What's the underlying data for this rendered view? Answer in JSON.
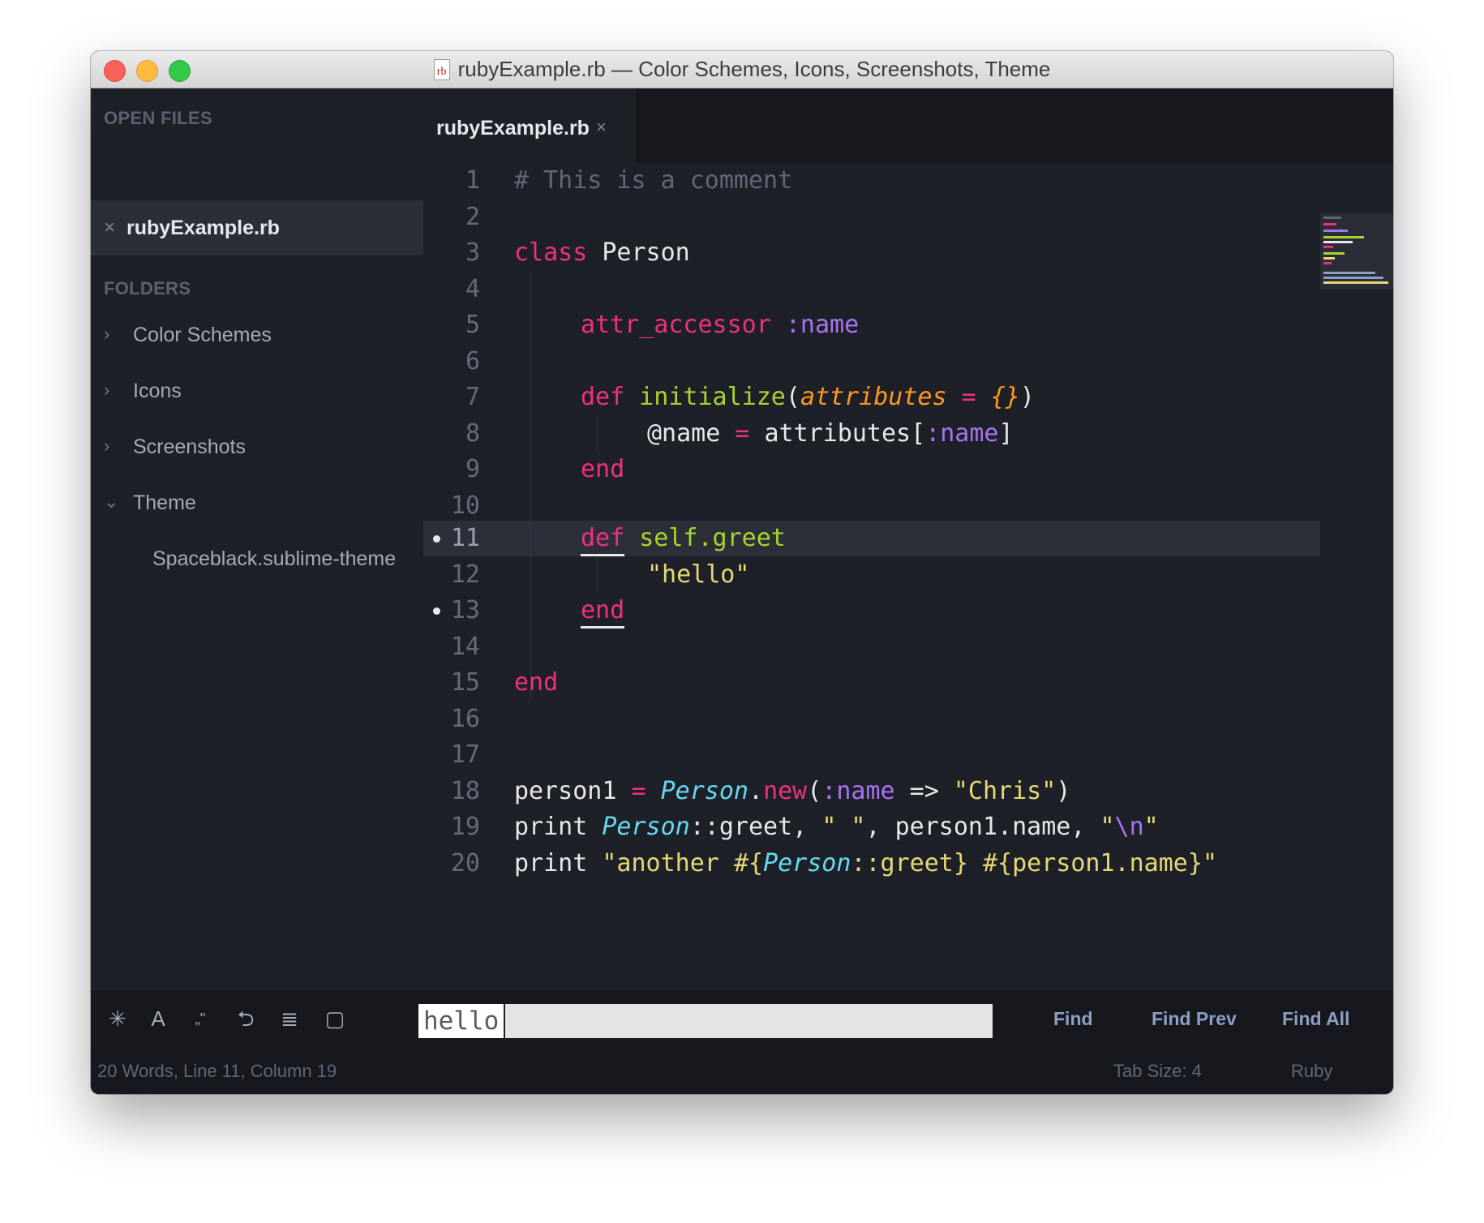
{
  "window": {
    "title": "rubyExample.rb — Color Schemes, Icons, Screenshots, Theme",
    "file_icon_text": "rb"
  },
  "sidebar": {
    "open_files_header": "OPEN FILES",
    "open_files": [
      {
        "close": "×",
        "name": "rubyExample.rb"
      }
    ],
    "folders_header": "FOLDERS",
    "folders": [
      {
        "arrow": "›",
        "label": "Color Schemes",
        "expanded": false
      },
      {
        "arrow": "›",
        "label": "Icons",
        "expanded": false
      },
      {
        "arrow": "›",
        "label": "Screenshots",
        "expanded": false
      },
      {
        "arrow": "⌄",
        "label": "Theme",
        "expanded": true
      }
    ],
    "theme_files": [
      "Spaceblack.sublime-theme"
    ]
  },
  "tab": {
    "name": "rubyExample.rb",
    "close": "×"
  },
  "editor": {
    "line_numbers": [
      "1",
      "2",
      "3",
      "4",
      "5",
      "6",
      "7",
      "8",
      "9",
      "10",
      "11",
      "12",
      "13",
      "14",
      "15",
      "16",
      "17",
      "18",
      "19",
      "20"
    ],
    "current_line": 11,
    "dirty_lines": [
      11,
      13
    ],
    "code": {
      "l1": "# This is a comment",
      "l3_kw": "class",
      "l3_name": " Person",
      "l5_fn": "attr_accessor",
      "l5_sym": " :name",
      "l7_kw": "def",
      "l7_fn": " initialize",
      "l7_p1": "(",
      "l7_param": "attributes",
      "l7_eq": " = ",
      "l7_def": "{}",
      "l7_p2": ")",
      "l8_ivar": "@name",
      "l8_eq": " = ",
      "l8_attr": "attributes[",
      "l8_sym": ":name",
      "l8_close": "]",
      "l9_kw": "end",
      "l11_kw": "def",
      "l11_fn": " self.greet",
      "l12_str": "\"hello\"",
      "l13_kw": "end",
      "l15_kw": "end",
      "l18_a": "person1",
      "l18_eq": " = ",
      "l18_cls": "Person",
      "l18_dot": ".",
      "l18_new": "new",
      "l18_p": "(",
      "l18_sym": ":name",
      "l18_arrow": " => ",
      "l18_str": "\"Chris\"",
      "l18_close": ")",
      "l19_print": "print ",
      "l19_cls": "Person",
      "l19_greet": "::greet, ",
      "l19_s1": "\" \"",
      "l19_mid": ", person1.name, ",
      "l19_q1": "\"",
      "l19_esc": "\\n",
      "l19_q2": "\"",
      "l20_print": "print ",
      "l20_s1": "\"another ",
      "l20_i1": "#{",
      "l20_cls": "Person",
      "l20_g": "::greet",
      "l20_i2": "}",
      "l20_sp": " ",
      "l20_i3": "#{",
      "l20_pn": "person1.name",
      "l20_i4": "}",
      "l20_q": "\""
    }
  },
  "colors": {
    "background": "#1e2028",
    "keyword": "#f0307e",
    "symbol": "#a873f0",
    "function": "#a6d52c",
    "parameter": "#fd971f",
    "string": "#e6d874",
    "class": "#66d9ef",
    "comment": "#5f6776"
  },
  "findbar": {
    "icons": [
      "regex-icon",
      "case-sensitive-icon",
      "whole-word-icon",
      "wrap-icon",
      "in-selection-icon",
      "highlight-matches-icon"
    ],
    "icon_glyphs": [
      "✳",
      "A",
      "„\"",
      "⮌",
      "≣",
      "▢"
    ],
    "query": "hello",
    "find_label": "Find",
    "find_prev_label": "Find Prev",
    "find_all_label": "Find All"
  },
  "statusbar": {
    "position": "20 Words, Line 11, Column 19",
    "tab_size": "Tab Size: 4",
    "syntax": "Ruby"
  }
}
